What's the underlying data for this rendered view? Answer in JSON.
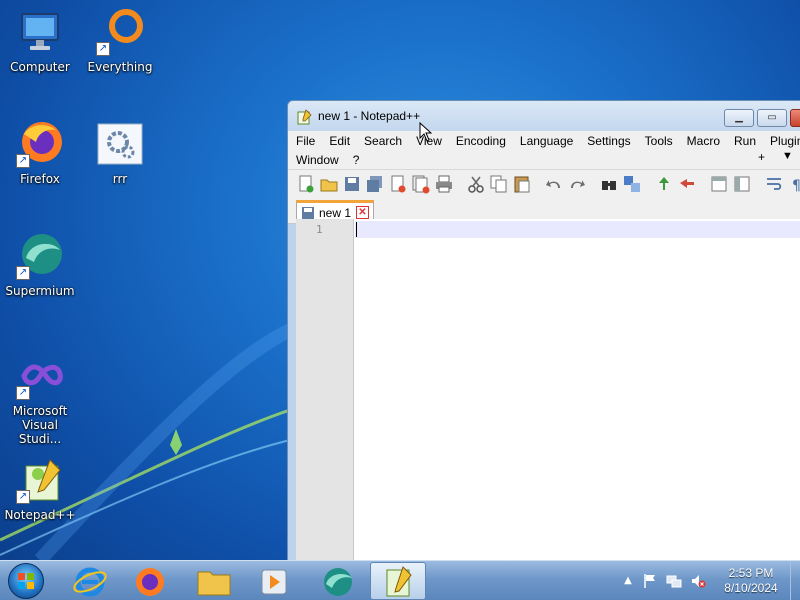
{
  "desktop": {
    "icons": [
      {
        "label": "Computer",
        "icon": "computer-icon"
      },
      {
        "label": "Everything",
        "icon": "everything-icon"
      },
      {
        "label": "Firefox",
        "icon": "firefox-icon"
      },
      {
        "label": "rrr",
        "icon": "settings-icon"
      },
      {
        "label": "Supermium",
        "icon": "supermium-icon"
      },
      {
        "label_line1": "Microsoft",
        "label_line2": "Visual Studi...",
        "icon": "visual-studio-icon"
      },
      {
        "label": "Notepad++",
        "icon": "notepad-plus-plus-icon"
      }
    ]
  },
  "window": {
    "title": "new 1 - Notepad++",
    "menu": {
      "row1": [
        "File",
        "Edit",
        "Search",
        "View",
        "Encoding",
        "Language",
        "Settings",
        "Tools",
        "Macro",
        "Run",
        "Plugin"
      ],
      "row2": [
        "Window",
        "?"
      ],
      "plus": "+",
      "dropdown": "▼"
    },
    "tab": {
      "label": "new 1",
      "close": "✕"
    },
    "editor": {
      "line_number": "1"
    }
  },
  "taskbar": {
    "clock_time": "2:53 PM",
    "clock_date": "8/10/2024",
    "tray_chevron": "▲"
  },
  "colors": {
    "tab_accent": "#f2a33a",
    "close_button": "#c9432d",
    "current_line": "#e8e8ff"
  }
}
